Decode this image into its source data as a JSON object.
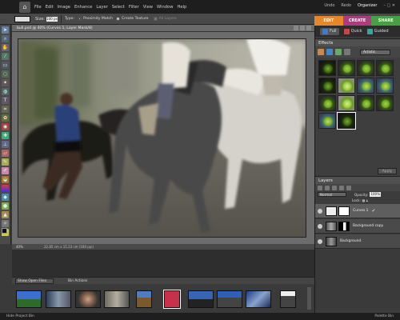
{
  "menubar": {
    "home_icon": "home-icon",
    "items": [
      "File",
      "Edit",
      "Image",
      "Enhance",
      "Layer",
      "Select",
      "Filter",
      "View",
      "Window",
      "Help"
    ],
    "undo": "Undo",
    "redo": "Redo",
    "organizer": "Organizer"
  },
  "options": {
    "size_label": "Size:",
    "size_value": "100 px",
    "type_label": "Type:",
    "opt1": "Proximity Match",
    "opt2": "Create Texture",
    "opt3": "All Layers"
  },
  "tabs": {
    "edit": "EDIT",
    "create": "CREATE",
    "share": "SHARE"
  },
  "document": {
    "title": "bull.psd @ 40% (Curves 1, Layer Mask/8)",
    "zoom": "40%",
    "dims": "22.85 cm x 15.23 cm (180 ppi)"
  },
  "modes": {
    "full": "Full",
    "quick": "Quick",
    "guided": "Guided"
  },
  "effects": {
    "title": "Effects",
    "category": "Artistic",
    "apply": "Apply"
  },
  "layers": {
    "title": "Layers",
    "blend": "Normal",
    "opacity_label": "Opacity:",
    "opacity_value": "100%",
    "lock_label": "Lock:",
    "items": [
      {
        "name": "Curves 1"
      },
      {
        "name": "Background copy"
      },
      {
        "name": "Background"
      }
    ]
  },
  "bin": {
    "show_label": "Show Open Files",
    "actions_label": "Bin Actions"
  },
  "status": {
    "hide_bin": "Hide Project Bin",
    "palette_bin": "Palette Bin"
  },
  "colors": {
    "edit": "#e8862a",
    "create": "#b03a7f",
    "share": "#47a043"
  }
}
